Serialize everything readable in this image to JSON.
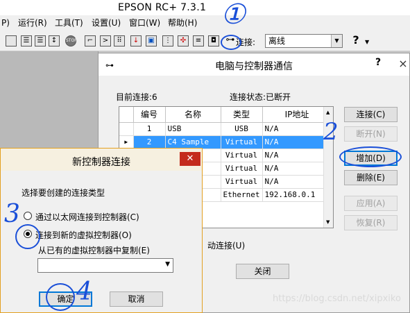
{
  "app": {
    "title": "EPSON RC+ 7.3.1",
    "menu": [
      "P)",
      "运行(R)",
      "工具(T)",
      "设置(U)",
      "窗口(W)",
      "帮助(H)"
    ],
    "toolbar": {
      "connect_label": "连接:",
      "connect_value": "离线",
      "help_glyph": "?"
    }
  },
  "pc_dialog": {
    "title": "电脑与控制器通信",
    "help_glyph": "?",
    "close_glyph": "×",
    "current_connection": "目前连接:6",
    "status": "连接状态:已断开",
    "columns": [
      "编号",
      "名称",
      "类型",
      "IP地址"
    ],
    "rows": [
      {
        "num": "1",
        "name": "USB",
        "type": "USB",
        "ip": "N/A",
        "selected": false
      },
      {
        "num": "2",
        "name": "C4 Sample",
        "type": "Virtual",
        "ip": "N/A",
        "selected": true
      },
      {
        "num": "",
        "name": "",
        "type": "Virtual",
        "ip": "N/A",
        "selected": false
      },
      {
        "num": "",
        "name": "",
        "type": "Virtual",
        "ip": "N/A",
        "selected": false
      },
      {
        "num": "",
        "name": "",
        "type": "Virtual",
        "ip": "N/A",
        "selected": false
      },
      {
        "num": "",
        "name": "",
        "type": "Ethernet",
        "ip": "192.168.0.1",
        "selected": false
      }
    ],
    "buttons": {
      "connect": "连接(C)",
      "disconnect": "断开(N)",
      "add": "增加(D)",
      "delete": "删除(E)",
      "apply": "应用(A)",
      "restore": "恢复(R)",
      "close": "关闭"
    },
    "auto_connect": "动连接(U)"
  },
  "new_dialog": {
    "title": "新控制器连接",
    "close_glyph": "✕",
    "prompt": "选择要创建的连接类型",
    "option_ethernet": "通过以太网连接到控制器(C)",
    "option_virtual": "连接到新的虚拟控制器(O)",
    "copy_label": "从已有的虚拟控制器中复制(E)",
    "ok": "确定",
    "cancel": "取消"
  },
  "annotations": {
    "n1": "①",
    "n2": "2",
    "n3": "3",
    "n4": "4"
  },
  "watermark": "https://blog.csdn.net/xipxiko"
}
